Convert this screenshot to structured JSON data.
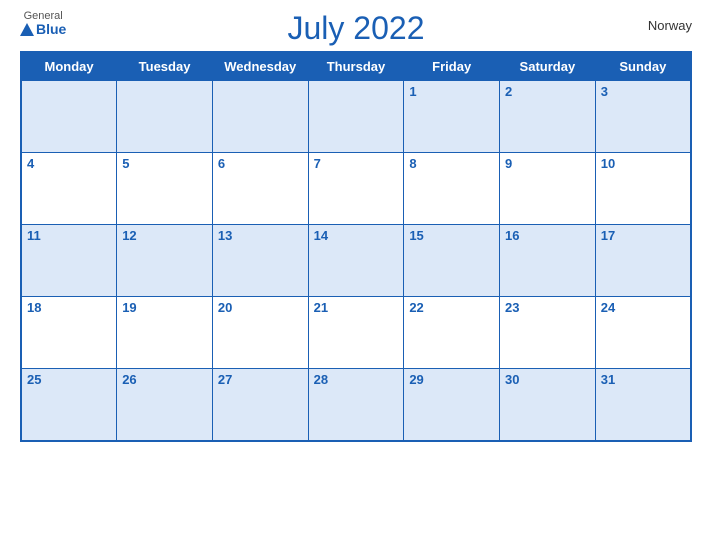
{
  "header": {
    "logo_general": "General",
    "logo_blue": "Blue",
    "title": "July 2022",
    "country": "Norway"
  },
  "days_of_week": [
    "Monday",
    "Tuesday",
    "Wednesday",
    "Thursday",
    "Friday",
    "Saturday",
    "Sunday"
  ],
  "weeks": [
    [
      null,
      null,
      null,
      null,
      1,
      2,
      3
    ],
    [
      4,
      5,
      6,
      7,
      8,
      9,
      10
    ],
    [
      11,
      12,
      13,
      14,
      15,
      16,
      17
    ],
    [
      18,
      19,
      20,
      21,
      22,
      23,
      24
    ],
    [
      25,
      26,
      27,
      28,
      29,
      30,
      31
    ]
  ]
}
